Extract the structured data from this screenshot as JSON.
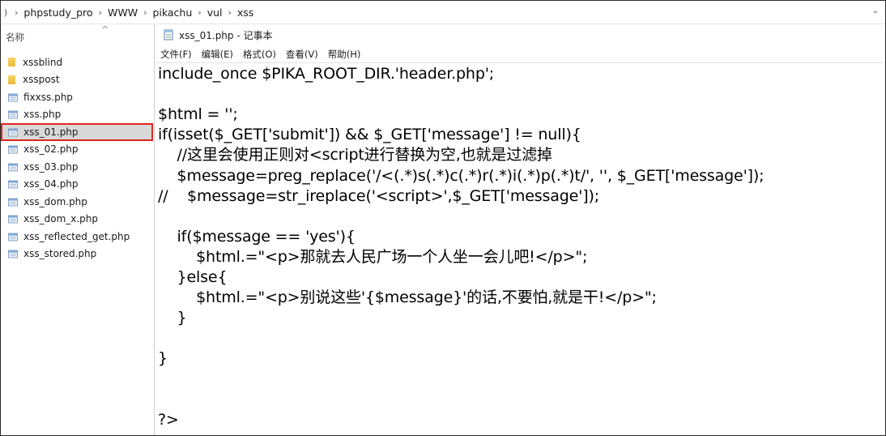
{
  "breadcrumb": {
    "lead": ")",
    "items": [
      "phpstudy_pro",
      "WWW",
      "pikachu",
      "vul",
      "xss"
    ],
    "separator": "›"
  },
  "explorer": {
    "column_header": "名称",
    "sort_indicator": "^",
    "files": [
      {
        "name": "xssblind",
        "type": "folder"
      },
      {
        "name": "xsspost",
        "type": "folder"
      },
      {
        "name": "fixxss.php",
        "type": "php"
      },
      {
        "name": "xss.php",
        "type": "php"
      },
      {
        "name": "xss_01.php",
        "type": "php",
        "selected": true
      },
      {
        "name": "xss_02.php",
        "type": "php"
      },
      {
        "name": "xss_03.php",
        "type": "php"
      },
      {
        "name": "xss_04.php",
        "type": "php"
      },
      {
        "name": "xss_dom.php",
        "type": "php"
      },
      {
        "name": "xss_dom_x.php",
        "type": "php"
      },
      {
        "name": "xss_reflected_get.php",
        "type": "php"
      },
      {
        "name": "xss_stored.php",
        "type": "php"
      }
    ]
  },
  "notepad": {
    "title": "xss_01.php - 记事本",
    "menu": [
      "文件(F)",
      "编辑(E)",
      "格式(O)",
      "查看(V)",
      "帮助(H)"
    ],
    "lines": [
      "include_once $PIKA_ROOT_DIR.'header.php';",
      "",
      "$html = '';",
      "if(isset($_GET['submit']) && $_GET['message'] != null){",
      "    //这里会使用正则对<script进行替换为空,也就是过滤掉",
      "    $message=preg_replace('/<(.*)s(.*)c(.*)r(.*)i(.*)p(.*)t/', '', $_GET['message']);",
      "//    $message=str_ireplace('<script>',$_GET['message']);",
      "",
      "    if($message == 'yes'){",
      "        $html.=\"<p>那就去人民广场一个人坐一会儿吧!</p>\";",
      "    }else{",
      "        $html.=\"<p>别说这些'{$message}'的话,不要怕,就是干!</p>\";",
      "    }",
      "",
      "}",
      "",
      "",
      "?>"
    ]
  },
  "colors": {
    "selection_bg": "#d9d9d9",
    "highlight_border": "#e0261e",
    "folder": "#f0c54f"
  }
}
